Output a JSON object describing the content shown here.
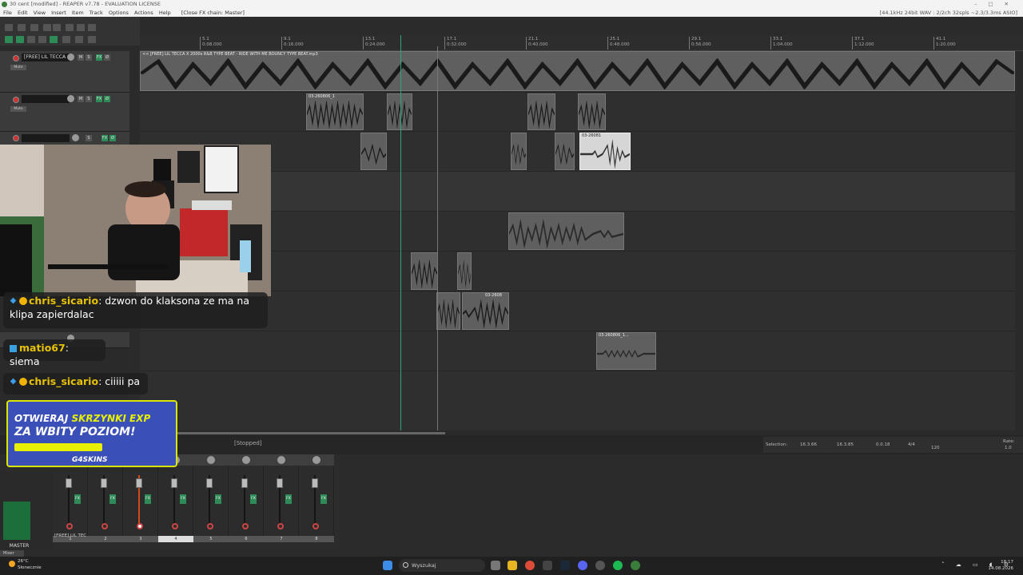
{
  "window": {
    "title": "30 cent [modified] - REAPER v7.78 - EVALUATION LICENSE",
    "audio_info": "[44.1kHz 24bit WAV : 2/2ch 32spls ~2.3/3.3ms ASIO]"
  },
  "menu": {
    "items": [
      "File",
      "Edit",
      "View",
      "Insert",
      "Item",
      "Track",
      "Options",
      "Actions",
      "Help"
    ],
    "extra": "[Close FX chain: Master]"
  },
  "ruler": {
    "ticks": [
      {
        "bar": "5.1",
        "time": "0:08.000"
      },
      {
        "bar": "9.1",
        "time": "0:16.000"
      },
      {
        "bar": "13.1",
        "time": "0:24.000"
      },
      {
        "bar": "17.1",
        "time": "0:32.000"
      },
      {
        "bar": "21.1",
        "time": "0:40.000"
      },
      {
        "bar": "25.1",
        "time": "0:48.000"
      },
      {
        "bar": "29.1",
        "time": "0:56.000"
      },
      {
        "bar": "33.1",
        "time": "1:04.000"
      },
      {
        "bar": "37.1",
        "time": "1:12.000"
      },
      {
        "bar": "41.1",
        "time": "1:20.000"
      }
    ]
  },
  "tracks": [
    {
      "name": "[FREE] LIL TECCA",
      "mode": "Mute"
    },
    {
      "name": "",
      "mode": "Mute"
    },
    {
      "name": "",
      "mode": ""
    }
  ],
  "items": {
    "beat": "<< [FREE] LIL TECCA X 2000s R&B TYPE BEAT - RIDE WITH ME  BOUNCY TYPE BEAT.mp3",
    "vocal1": "03-260806_1",
    "vocal2": "03-26081",
    "vocal3": "03-2608",
    "vocal4": "03-260806_1..."
  },
  "transport": {
    "status": "[Stopped]"
  },
  "selection": {
    "label": "Selection:",
    "start": "16.3.66",
    "end": "16.3.85",
    "length": "0.0.18",
    "timesig": "4/4",
    "bpm": "120",
    "rate_label": "Rate:",
    "rate": "1.0"
  },
  "mixer": {
    "master_label": "MASTER",
    "first_track_name": "[FREE] LIL TEC",
    "tab": "Mixer",
    "strip_numbers": [
      "1",
      "2",
      "3",
      "4",
      "5",
      "6",
      "7",
      "8"
    ]
  },
  "stream": {
    "chat": [
      {
        "user": "chris_sicario",
        "text": "dzwon do klaksona ze ma na klipa zapierdalac"
      },
      {
        "user": "matio67",
        "text": "siema"
      },
      {
        "user": "chris_sicario",
        "text": "ciiiii pa"
      }
    ],
    "promo": {
      "line1a": "OTWIERAJ ",
      "line1b": "SKRZYNKI EXP",
      "line2": "ZA WBITY POZIOM!",
      "brand": "G4SKINS"
    }
  },
  "taskbar": {
    "weather_temp": "26°C",
    "weather_desc": "Słonecznie",
    "search_placeholder": "Wyszukaj",
    "time": "18:17",
    "date": "14.08.2026"
  },
  "colors": {
    "accent": "#2e8a57",
    "record": "#cc3333",
    "promo_yellow": "#e6f000"
  }
}
